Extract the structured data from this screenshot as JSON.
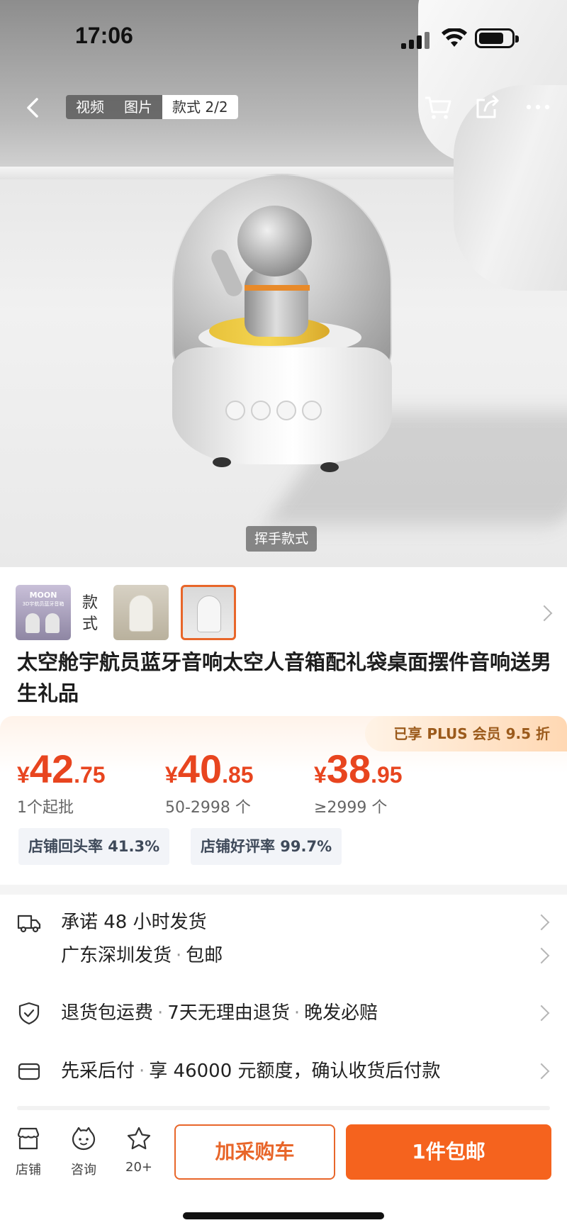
{
  "status_bar": {
    "time": "17:06"
  },
  "media_tabs": [
    {
      "label": "视频"
    },
    {
      "label": "图片"
    },
    {
      "label": "款式 2/2"
    }
  ],
  "hero": {
    "caption": "挥手款式"
  },
  "styles": {
    "label": "款式",
    "thumb1_text": "MOON",
    "thumb1_sub": "3D宇航员蓝牙音箱"
  },
  "product": {
    "title": "太空舱宇航员蓝牙音响太空人音箱配礼袋桌面摆件音响送男生礼品"
  },
  "pricing": {
    "plus_badge": "已享 PLUS 会员 9.5 折",
    "tiers": [
      {
        "currency": "¥",
        "int": "42",
        "dec": ".75",
        "qty": "1个起批"
      },
      {
        "currency": "¥",
        "int": "40",
        "dec": ".85",
        "qty": "50-2998 个"
      },
      {
        "currency": "¥",
        "int": "38",
        "dec": ".95",
        "qty": "≥2999 个"
      }
    ],
    "stats": [
      {
        "text": "店铺回头率 41.3%"
      },
      {
        "text": "店铺好评率 99.7%"
      }
    ]
  },
  "info": {
    "shipping_promise": "承诺 48 小时发货",
    "shipping_from": "广东深圳发货",
    "shipping_free": "包邮",
    "return_1": "退货包运费",
    "return_2": "7天无理由退货",
    "return_3": "晚发必赔",
    "pay_1": "先采后付",
    "pay_2": "享 46000 元额度，确认收货后付款"
  },
  "bottom_bar": {
    "store": "店铺",
    "consult": "咨询",
    "fav_count": "20+",
    "add_cart": "加采购车",
    "buy": "1件包邮"
  },
  "colors": {
    "accent": "#f5631e",
    "price": "#e8451f",
    "plus_text": "#9b5a1b"
  }
}
